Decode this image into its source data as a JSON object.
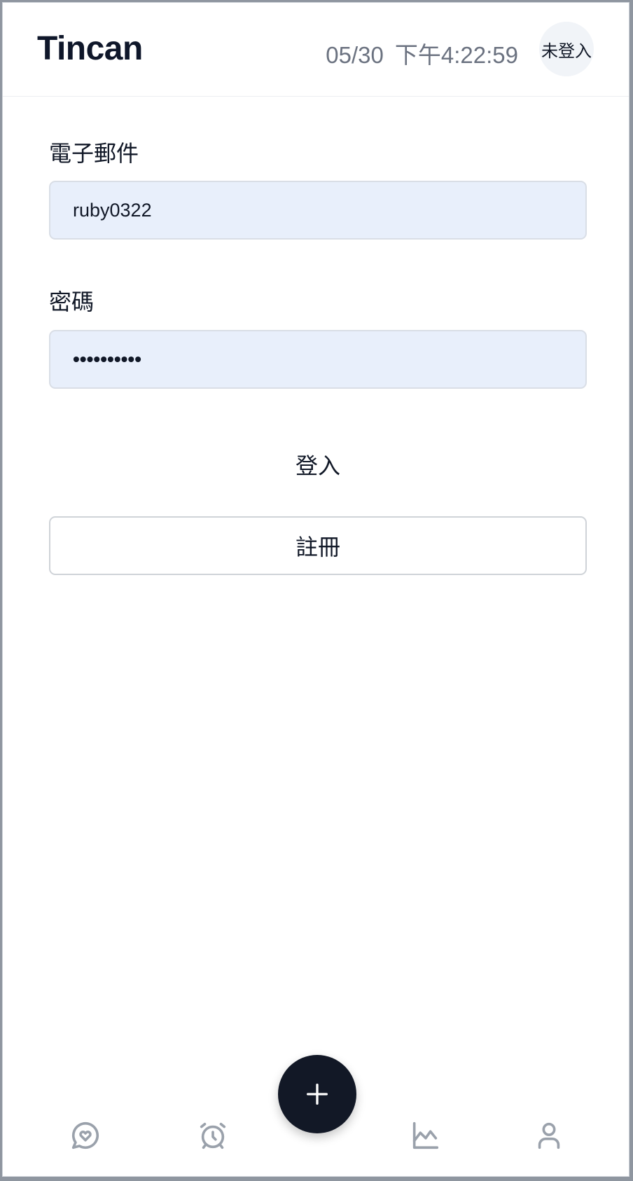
{
  "header": {
    "app_title": "Tincan",
    "date": "05/30",
    "time": "下午4:22:59",
    "login_status": "未登入"
  },
  "form": {
    "email_label": "電子郵件",
    "email_value": "ruby0322",
    "password_label": "密碼",
    "password_masked": "••••••••••",
    "login_button": "登入",
    "register_button": "註冊"
  },
  "bottom_nav": {
    "items": [
      {
        "icon": "chat-heart-icon"
      },
      {
        "icon": "alarm-clock-icon"
      },
      {
        "icon": "plus-icon"
      },
      {
        "icon": "chart-icon"
      },
      {
        "icon": "user-icon"
      }
    ]
  },
  "colors": {
    "input_bg": "#e8effb",
    "fab_bg": "#121826",
    "icon_gray": "#9aa1ab",
    "text_muted": "#6b7280"
  }
}
